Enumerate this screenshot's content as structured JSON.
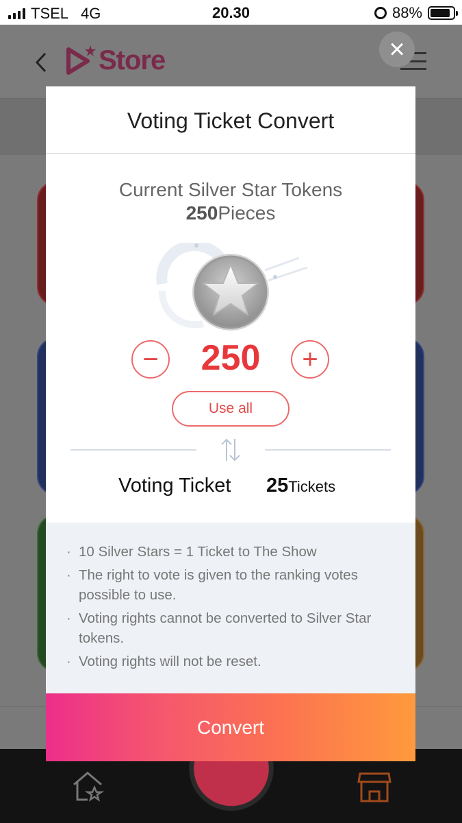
{
  "status_bar": {
    "carrier": "TSEL",
    "network": "4G",
    "time": "20.30",
    "battery": "88%",
    "battery_level": 0.88
  },
  "header": {
    "logo_text": "Store"
  },
  "modal": {
    "title": "Voting Ticket Convert",
    "current_label": "Current Silver Star Tokens",
    "current_value": "250",
    "current_unit": "Pieces",
    "stepper_value": "250",
    "use_all_label": "Use all",
    "result_label": "Voting Ticket",
    "result_value": "25",
    "result_unit": "Tickets",
    "notes": [
      "10 Silver Stars = 1 Ticket to The Show",
      "The right to vote is given to the ranking votes possible to use.",
      "Voting rights cannot be converted to Silver Star tokens.",
      "Voting rights will not be reset."
    ],
    "convert_label": "Convert"
  },
  "colors": {
    "accent": "#e8373b",
    "gradient_start": "#ec2f8a",
    "gradient_end": "#ff9a3c"
  },
  "icons": {
    "back": "chevron-left-icon",
    "close": "close-icon",
    "menu": "hamburger-menu-icon",
    "star_token": "silver-star-icon",
    "swap": "swap-arrows-icon",
    "home": "home-star-icon",
    "store": "store-icon"
  }
}
